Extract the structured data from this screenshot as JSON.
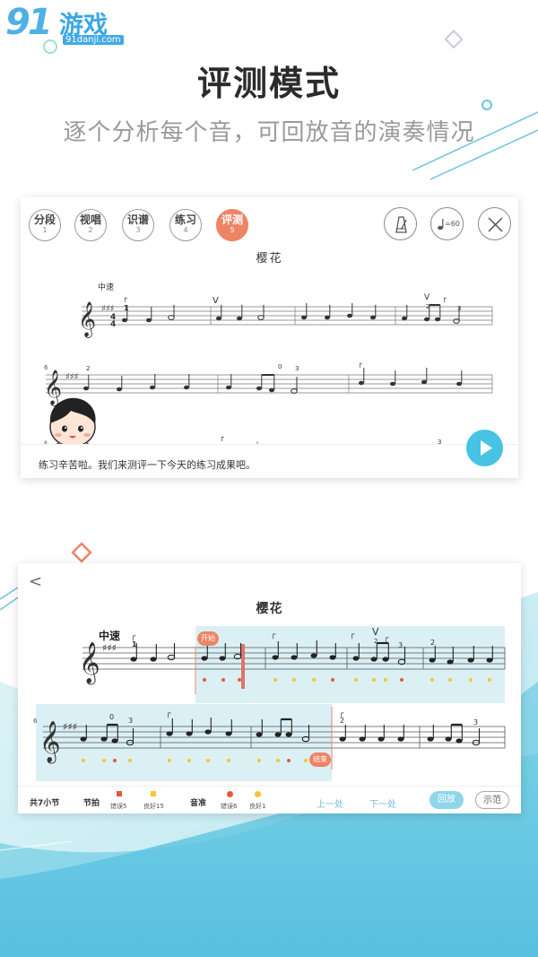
{
  "watermark": {
    "number": "91",
    "name": "游戏",
    "url": "91danji.com"
  },
  "headline": "评测模式",
  "subline": "逐个分析每个音，可回放音的演奏情况",
  "card1": {
    "modes": [
      {
        "label": "分段",
        "num": "1"
      },
      {
        "label": "视唱",
        "num": "2"
      },
      {
        "label": "识谱",
        "num": "3"
      },
      {
        "label": "练习",
        "num": "4"
      },
      {
        "label": "评测",
        "num": "5"
      }
    ],
    "active_mode": 4,
    "tempo_value": "=60",
    "song_title": "樱花",
    "tempo": "中速",
    "measure_number_2": "6",
    "measure_number_3": "8",
    "message": "练习辛苦啦。我们来测评一下今天的练习成果吧。"
  },
  "card2": {
    "back": "<",
    "song_title": "樱花",
    "tempo": "中速",
    "measure_number_2": "6",
    "bubble_start": "开始",
    "bubble_end": "结束",
    "footer": {
      "total": "共7小节",
      "rhythm_label": "节拍",
      "rhythm_wrong": "错误5",
      "rhythm_good": "良好15",
      "pitch_label": "音准",
      "pitch_wrong": "错误6",
      "pitch_good": "良好1",
      "prev": "上一处",
      "next": "下一处",
      "replay": "回放",
      "demo": "示范"
    }
  },
  "colors": {
    "accent_orange": "#ee8466",
    "play_blue": "#47c3e3",
    "highlight": "#dbf0f5",
    "dot_red": "#e6593c",
    "dot_yellow": "#f7c531"
  }
}
